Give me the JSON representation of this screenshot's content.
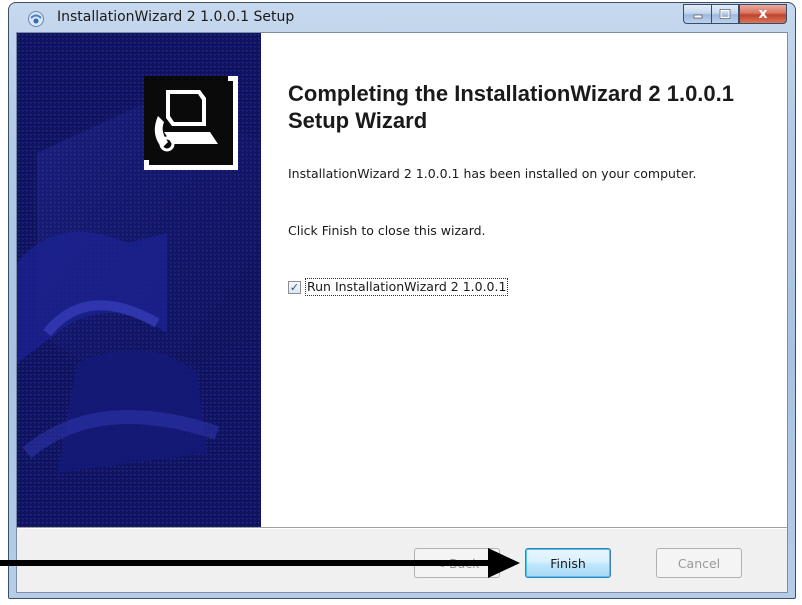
{
  "window": {
    "title": "InstallationWizard 2 1.0.0.1 Setup",
    "close_glyph": "x"
  },
  "content": {
    "heading": "Completing the InstallationWizard 2 1.0.0.1 Setup Wizard",
    "installed_message": "InstallationWizard 2 1.0.0.1 has been installed on your computer.",
    "finish_instruction": "Click Finish to close this wizard.",
    "run_checkbox": {
      "label": "Run InstallationWizard 2 1.0.0.1",
      "checked": true,
      "check_glyph": "✓"
    }
  },
  "buttons": {
    "back": "< Back",
    "finish": "Finish",
    "cancel": "Cancel"
  },
  "colors": {
    "banner_background": "#10135e",
    "annotation_arrow": "#000000"
  }
}
